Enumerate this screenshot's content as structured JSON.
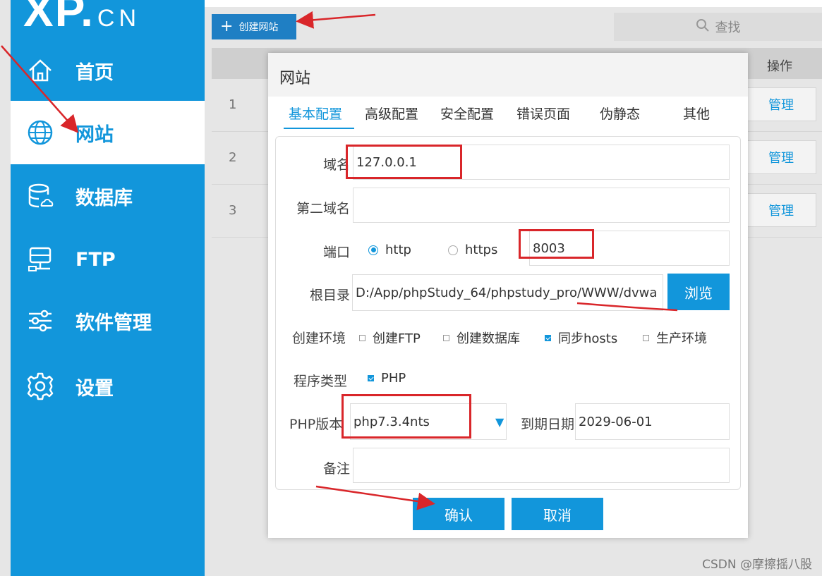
{
  "logo": {
    "main": "XP.",
    "suffix": "CN"
  },
  "sidebar": {
    "items": [
      {
        "label": "首页",
        "icon": "home-icon"
      },
      {
        "label": "网站",
        "icon": "globe-icon",
        "active": true
      },
      {
        "label": "数据库",
        "icon": "database-icon"
      },
      {
        "label": "FTP",
        "icon": "server-icon"
      },
      {
        "label": "软件管理",
        "icon": "sliders-icon"
      },
      {
        "label": "设置",
        "icon": "gear-icon"
      }
    ]
  },
  "toolbar": {
    "create_label": "创建网站",
    "search_label": "查找"
  },
  "table": {
    "op_header": "操作",
    "rows": [
      {
        "num": "1",
        "action": "管理"
      },
      {
        "num": "2",
        "action": "管理"
      },
      {
        "num": "3",
        "action": "管理"
      }
    ]
  },
  "dialog": {
    "title": "网站",
    "tabs": [
      "基本配置",
      "高级配置",
      "安全配置",
      "错误页面",
      "伪静态",
      "其他"
    ],
    "active_tab": "基本配置",
    "form": {
      "domain_label": "域名",
      "domain_value": "127.0.0.1",
      "second_domain_label": "第二域名",
      "second_domain_value": "",
      "port_label": "端口",
      "http_label": "http",
      "https_label": "https",
      "protocol_selected": "http",
      "port_value": "8003",
      "root_label": "根目录",
      "root_value": "D:/App/phpStudy_64/phpstudy_pro/WWW/dvwa",
      "browse_label": "浏览",
      "env_label": "创建环境",
      "env_options": [
        {
          "label": "创建FTP",
          "checked": false
        },
        {
          "label": "创建数据库",
          "checked": false
        },
        {
          "label": "同步hosts",
          "checked": true
        },
        {
          "label": "生产环境",
          "checked": false
        }
      ],
      "program_label": "程序类型",
      "program_php": "PHP",
      "php_version_label": "PHP版本",
      "php_version_value": "php7.3.4nts",
      "expiry_label": "到期日期",
      "expiry_value": "2029-06-01",
      "note_label": "备注",
      "note_value": ""
    },
    "confirm_label": "确认",
    "cancel_label": "取消"
  },
  "watermark": "CSDN @摩擦摇八股",
  "colors": {
    "accent": "#1296db",
    "annotation": "#d9262a"
  }
}
